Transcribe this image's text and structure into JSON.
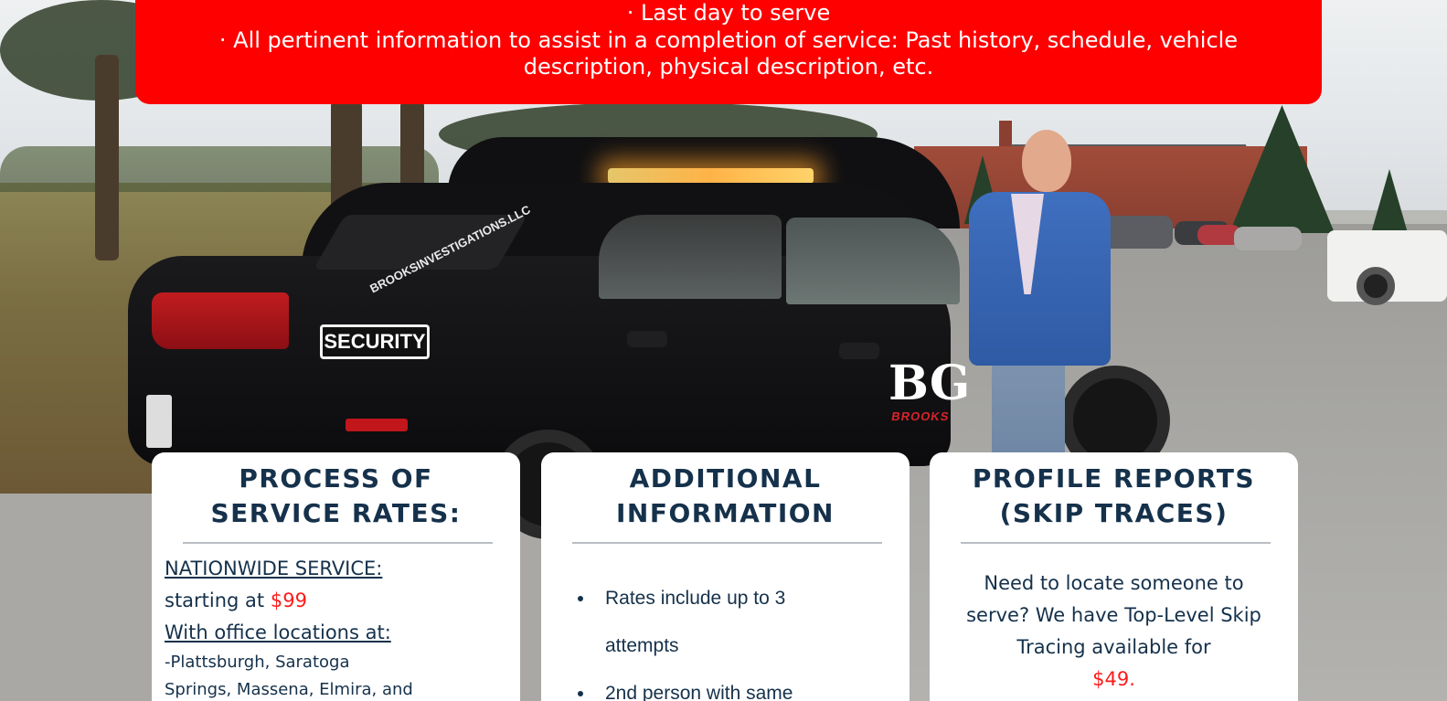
{
  "banner": {
    "line1": "· Last day to serve",
    "line2": "· All pertinent information to assist in a completion of service: Past history, schedule, vehicle description, physical description, etc."
  },
  "photo": {
    "badge_text": "SECURITY",
    "window_decal": "BROOKSINVESTIGATIONS.LLC",
    "logo_monogram": "BG",
    "logo_brand": "BROOKS"
  },
  "cards": {
    "rates": {
      "title_line1": "PROCESS OF",
      "title_line2": "SERVICE RATES:",
      "nationwide_label": "NATIONWIDE SERVICE:",
      "starting_text": "starting at",
      "starting_price": "$99",
      "offices_label": "With office locations at:",
      "offices_line1": "-Plattsburgh, Saratoga",
      "offices_line2": "Springs, Massena, Elmira, and"
    },
    "info": {
      "title_line1": "ADDITIONAL",
      "title_line2": "INFORMATION",
      "bullets": [
        "Rates include up to 3",
        "attempts",
        "2nd person with same"
      ]
    },
    "profile": {
      "title_line1": "PROFILE REPORTS",
      "title_line2": "(SKIP TRACES)",
      "body": "Need to locate someone to serve? We have Top-Level Skip Tracing available for",
      "price": "$49."
    }
  },
  "colors": {
    "banner_red": "#ff0000",
    "navy_text": "#15314b",
    "price_red": "#ff1a1a"
  }
}
